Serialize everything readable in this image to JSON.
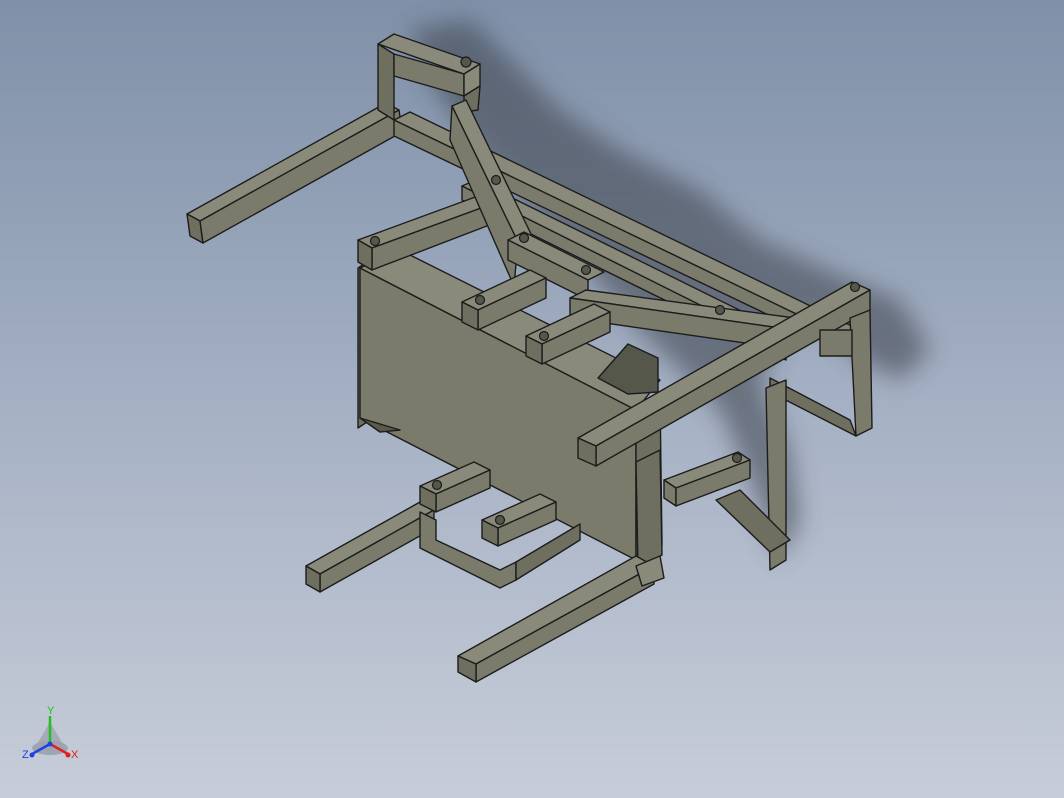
{
  "viewport": {
    "background_top": "#7f90a8",
    "background_bottom": "#c7cdd8",
    "model": {
      "face_colors": {
        "top": "#8a8a7a",
        "left": "#6f6f60",
        "front": "#7b7b6b",
        "dark": "#5a5a4c"
      },
      "edge_color": "#1c1c1c"
    }
  },
  "triad": {
    "x_label": "X",
    "y_label": "Y",
    "z_label": "Z",
    "x_color": "#e02020",
    "y_color": "#20c020",
    "z_color": "#2040e0"
  }
}
